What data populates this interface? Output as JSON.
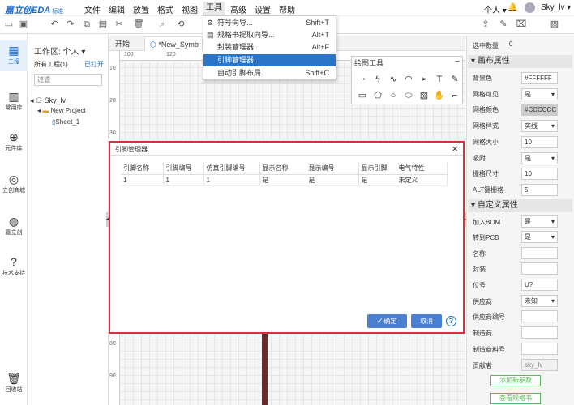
{
  "menubar": {
    "logo": "嘉立创EDA",
    "edition": "标准",
    "items": [
      "文件",
      "编辑",
      "放置",
      "格式",
      "视图",
      "工具",
      "高级",
      "设置",
      "帮助"
    ],
    "right_person": "个人",
    "username": "Sky_lv"
  },
  "tools_menu": [
    {
      "label": "符号向导...",
      "shortcut": "Shift+T",
      "icon": "wand-icon"
    },
    {
      "label": "规格书提取向导...",
      "shortcut": "Alt+T",
      "icon": "doc-icon"
    },
    {
      "label": "封装管理器...",
      "shortcut": "Alt+F",
      "icon": ""
    },
    {
      "label": "引脚管理器...",
      "shortcut": "",
      "icon": ""
    },
    {
      "label": "自动引脚布局",
      "shortcut": "Shift+C",
      "icon": ""
    }
  ],
  "leftnav": [
    {
      "label": "工程",
      "icon": "project-icon"
    },
    {
      "label": "常用库",
      "icon": "library-icon"
    },
    {
      "label": "元件库",
      "icon": "component-search-icon"
    },
    {
      "label": "立创商城",
      "icon": "lcsc-icon"
    },
    {
      "label": "嘉立创",
      "icon": "jlc-icon"
    },
    {
      "label": "技术支持",
      "icon": "support-icon"
    },
    {
      "label": "回收站",
      "icon": "trash-icon"
    }
  ],
  "panel": {
    "workspace": "工作区: 个人 ▾",
    "all_projects": "所有工程(1)",
    "opened": "已打开",
    "filter_placeholder": "过滤",
    "tree_user": "Sky_lv",
    "tree_project": "New Project",
    "tree_sheet": "Sheet_1"
  },
  "tabs": [
    "开始",
    "*New_Symb"
  ],
  "rulers": {
    "h": [
      "100",
      "120"
    ],
    "v": [
      "10",
      "20",
      "30",
      "40",
      "50",
      "60",
      "70",
      "80",
      "90"
    ]
  },
  "drawtools": {
    "title": "绘图工具"
  },
  "dialog": {
    "title": "引脚管理器",
    "headers": [
      "引脚名称",
      "引脚编号",
      "仿真引脚编号",
      "显示名称",
      "显示编号",
      "显示引脚",
      "电气特性"
    ],
    "rows": [
      [
        "1",
        "1",
        "1",
        "是",
        "是",
        "是",
        "未定义"
      ]
    ],
    "ok": "确定",
    "cancel": "取消",
    "help": "?"
  },
  "right_panel": {
    "selected_label": "选中数量",
    "selected_count": "0",
    "canvas_section": "画布属性",
    "canvas_props": [
      {
        "label": "背景色",
        "value": "#FFFFFF",
        "select": false
      },
      {
        "label": "网格可见",
        "value": "是",
        "select": true
      },
      {
        "label": "网格颜色",
        "value": "#CCCCCC",
        "select": false
      },
      {
        "label": "网格样式",
        "value": "实线",
        "select": true
      },
      {
        "label": "网格大小",
        "value": "10",
        "select": false
      },
      {
        "label": "吸附",
        "value": "是",
        "select": true
      },
      {
        "label": "栅格尺寸",
        "value": "10",
        "select": false
      },
      {
        "label": "ALT键栅格",
        "value": "5",
        "select": false
      }
    ],
    "custom_section": "自定义属性",
    "custom_props": [
      {
        "label": "加入BOM",
        "value": "是",
        "select": true
      },
      {
        "label": "转到PCB",
        "value": "是",
        "select": true
      },
      {
        "label": "名称",
        "value": "",
        "select": false
      },
      {
        "label": "封装",
        "value": "",
        "select": false
      },
      {
        "label": "位号",
        "value": "U?",
        "select": false
      },
      {
        "label": "供应商",
        "value": "未知",
        "select": true
      },
      {
        "label": "供应商编号",
        "value": "",
        "select": false
      },
      {
        "label": "制造商",
        "value": "",
        "select": false
      },
      {
        "label": "制造商料号",
        "value": "",
        "select": false
      },
      {
        "label": "贡献者",
        "value": "sky_lv",
        "select": false
      }
    ],
    "add_param": "添加新参数",
    "view_spec": "查看规格书"
  }
}
